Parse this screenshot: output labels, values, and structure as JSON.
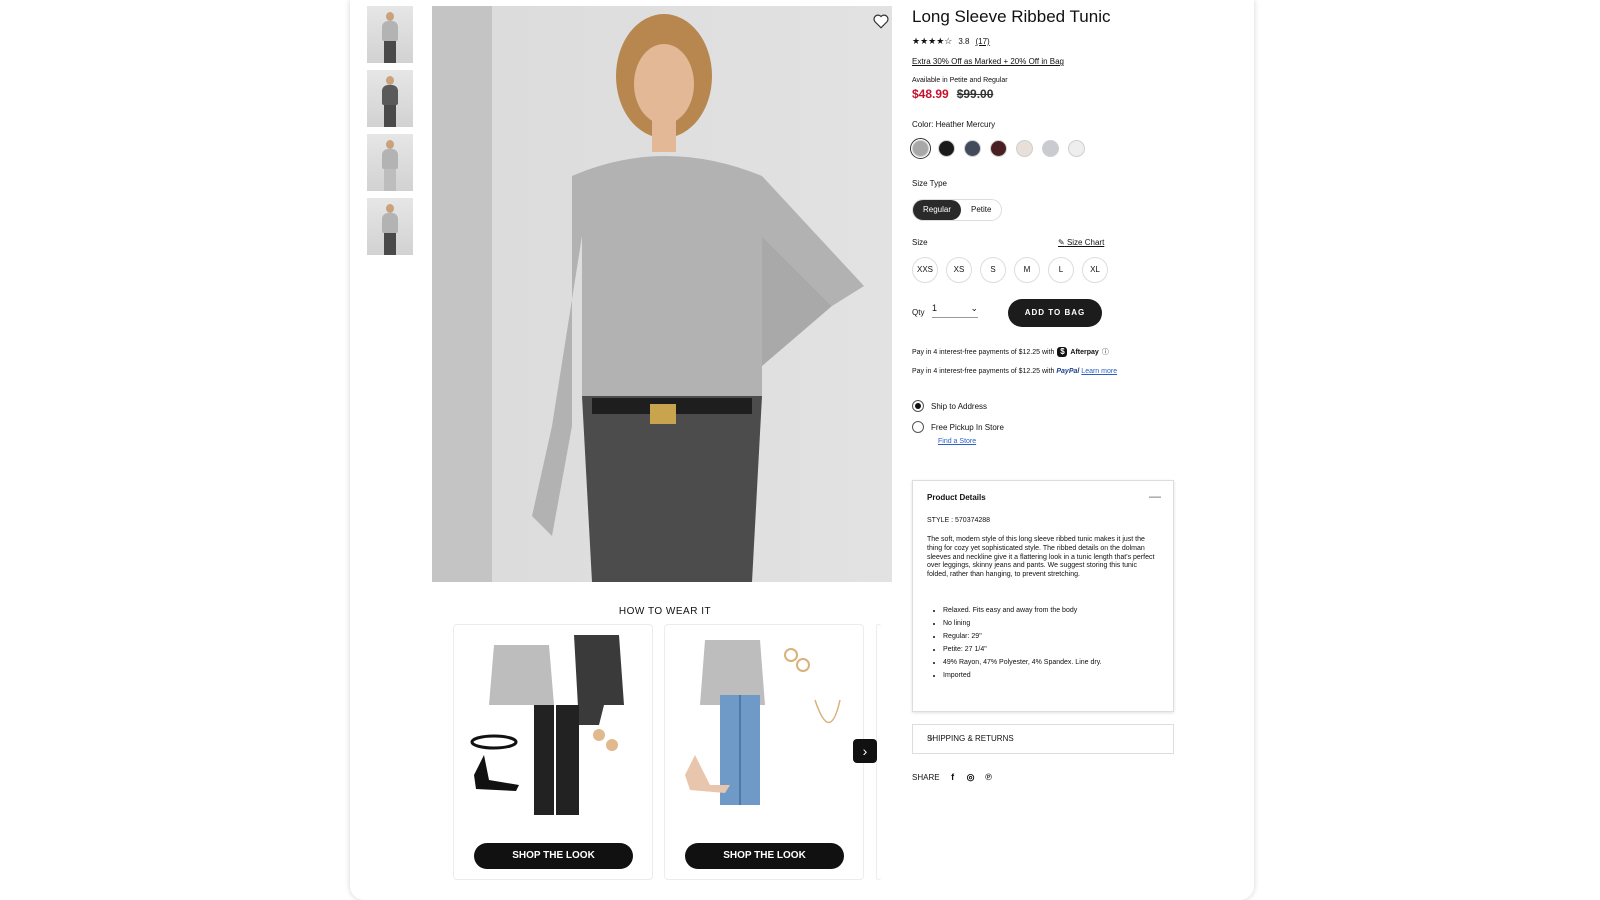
{
  "product": {
    "title": "Long Sleeve Ribbed Tunic",
    "rating_stars": "★★★★☆",
    "rating_value": "3.8",
    "review_count": "(17)",
    "promo": "Extra 30% Off as Marked + 20% Off in Bag",
    "availability": "Available in Petite and Regular",
    "sale_price": "$48.99",
    "original_price": "$99.00",
    "color_label": "Color:",
    "color_name": "Heather Mercury",
    "swatch_colors": [
      "#a8a8a8",
      "#1a1a1a",
      "#424a5c",
      "#4a1f24",
      "#e8e0d8",
      "#c9cbd1",
      "#eeeeee"
    ],
    "size_type_label": "Size Type",
    "size_types": [
      "Regular",
      "Petite"
    ],
    "size_label": "Size",
    "size_chart": "Size Chart",
    "sizes": [
      "XXS",
      "XS",
      "S",
      "M",
      "L",
      "XL"
    ],
    "qty_label": "Qty",
    "qty_value": "1",
    "add_to_bag": "ADD TO BAG",
    "afterpay_text": "Pay in 4 interest-free payments of $12.25 with",
    "afterpay_brand": "Afterpay",
    "paypal_text": "Pay in 4 interest-free payments of $12.25 with",
    "paypal_brand": "PayPal",
    "learn_more": "Learn more",
    "ship_to_address": "Ship to Address",
    "pickup": "Free Pickup In Store",
    "find_store": "Find a Store"
  },
  "details": {
    "heading": "Product Details",
    "style": "STYLE : 570374288",
    "description": "The soft, modern style of this long sleeve ribbed tunic makes it just the thing for cozy yet sophisticated style. The ribbed details on the dolman sleeves and neckline give it a flattering look in a tunic length that's perfect over leggings, skinny jeans and pants. We suggest storing this tunic folded, rather than hanging, to prevent stretching.",
    "bullets": [
      "Relaxed. Fits easy and away from the body",
      "No lining",
      "Regular: 29\"",
      "Petite: 27 1/4\"",
      "49% Rayon, 47% Polyester, 4% Spandex. Line dry.",
      "Imported"
    ],
    "shipping": "SHIPPING & RETURNS",
    "share": "SHARE"
  },
  "how_to_wear": {
    "title": "HOW TO WEAR IT",
    "shop_label": "SHOP THE LOOK"
  }
}
